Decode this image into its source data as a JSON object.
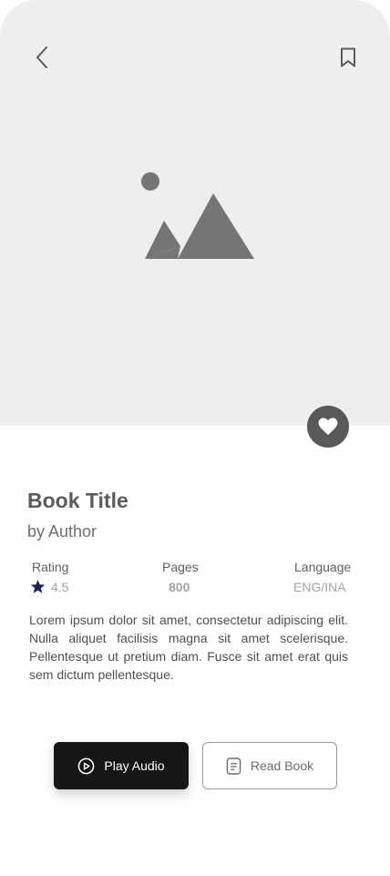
{
  "header": {
    "back_icon": "chevron-left-icon",
    "bookmark_icon": "bookmark-icon"
  },
  "cover": {
    "image_icon": "image-placeholder-icon",
    "favorite_icon": "heart-icon"
  },
  "book": {
    "title": "Book Title",
    "author": "by Author",
    "description": "Lorem ipsum dolor sit amet, consectetur adipiscing elit. Nulla aliquet facilisis magna sit amet scelerisque. Pellentesque ut pretium diam. Fusce sit amet erat quis sem dictum pellentesque."
  },
  "stats": {
    "rating_label": "Rating",
    "rating_value": "4.5",
    "pages_label": "Pages",
    "pages_value": "800",
    "language_label": "Language",
    "language_value": "ENG/INA"
  },
  "actions": {
    "play_label": "Play Audio",
    "read_label": "Read Book"
  },
  "colors": {
    "cover_bg": "#eeeeee",
    "primary_button": "#161616",
    "favorite_button": "#595959",
    "star": "#1a1f5e"
  }
}
